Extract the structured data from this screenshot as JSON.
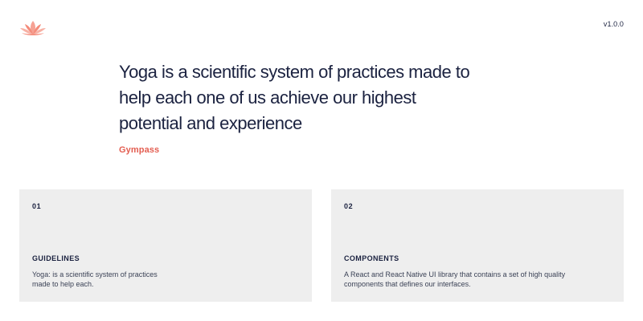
{
  "header": {
    "logo_icon": "lotus-icon",
    "logo_color": "#f48b7a",
    "version": "v1.0.0"
  },
  "hero": {
    "quote": "Yoga is a scientific system of practices made to help each one of us achieve our highest potential and experience",
    "author": "Gympass",
    "author_color": "#e35d50"
  },
  "cards": [
    {
      "number": "01",
      "title": "GUIDELINES",
      "description": "Yoga: is a scientific system of practices made to help each."
    },
    {
      "number": "02",
      "title": "COMPONENTS",
      "description": "A React and React Native UI library that contains a set of high quality components that defines our interfaces."
    }
  ],
  "colors": {
    "text_primary": "#1b2240",
    "card_background": "#eeeeee",
    "background": "#ffffff"
  }
}
